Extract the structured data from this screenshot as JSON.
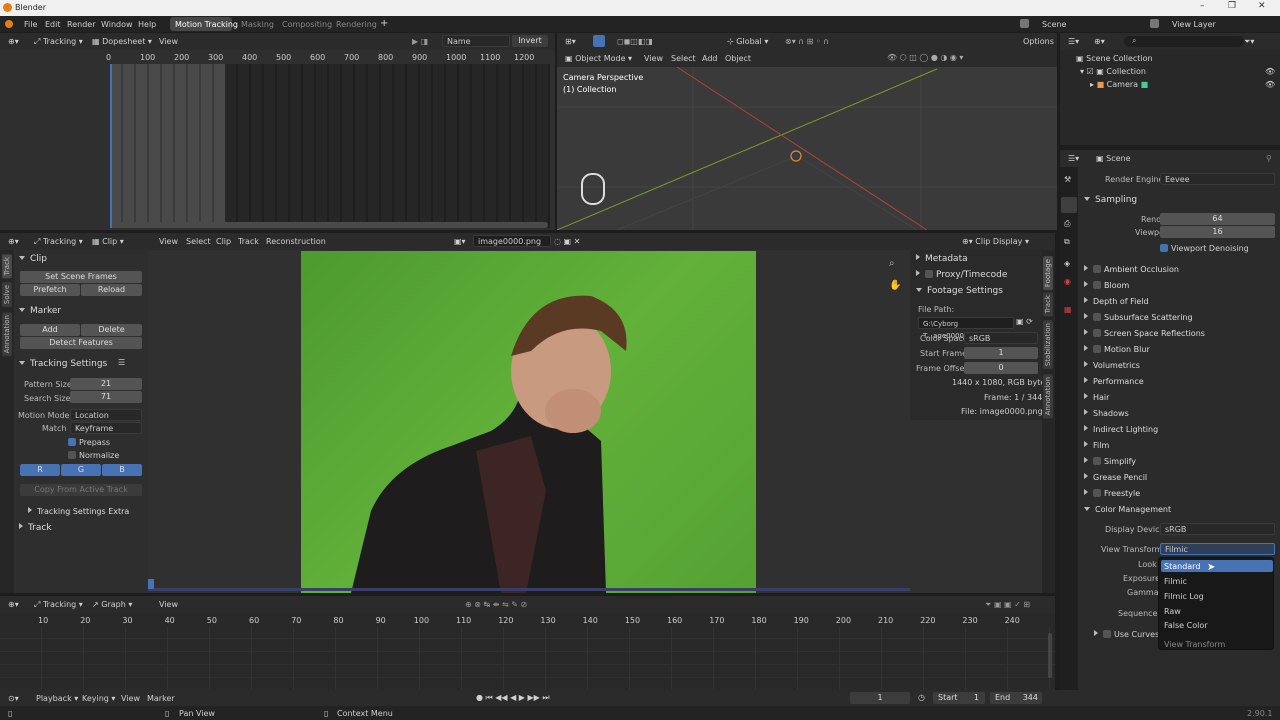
{
  "app": {
    "title": "Blender",
    "version": "2.90.1"
  },
  "topmenu": {
    "items": [
      "File",
      "Edit",
      "Render",
      "Window",
      "Help"
    ],
    "workspaces": [
      "Motion Tracking",
      "Masking",
      "Compositing",
      "Rendering"
    ],
    "add_tab": "+",
    "scene": "Scene",
    "view_layer": "View Layer"
  },
  "dopesheet": {
    "mode": "Tracking",
    "editor": "Dopesheet",
    "view": "View",
    "sort": "Name",
    "invert": "Invert",
    "ticks": [
      "0",
      "100",
      "200",
      "300",
      "400",
      "500",
      "600",
      "700",
      "800",
      "900",
      "1000",
      "1100",
      "1200"
    ]
  },
  "viewport3d": {
    "mode": "Object Mode",
    "menus": [
      "View",
      "Select",
      "Add",
      "Object"
    ],
    "orientation": "Global",
    "options": "Options",
    "overlay_title": "Camera Perspective",
    "overlay_sub": "(1) Collection"
  },
  "outliner": {
    "root": "Scene Collection",
    "collection": "Collection",
    "camera": "Camera"
  },
  "props": {
    "scene": "Scene",
    "render_engine_label": "Render Engine",
    "render_engine": "Eevee",
    "sampling": "Sampling",
    "render_label": "Render",
    "render_val": "64",
    "viewport_label": "Viewport",
    "viewport_val": "16",
    "denoise": "Viewport Denoising",
    "sections": [
      "Ambient Occlusion",
      "Bloom",
      "Depth of Field",
      "Subsurface Scattering",
      "Screen Space Reflections",
      "Motion Blur",
      "Volumetrics",
      "Performance",
      "Hair",
      "Shadows",
      "Indirect Lighting",
      "Film",
      "Simplify",
      "Grease Pencil",
      "Freestyle",
      "Color Management"
    ],
    "display_device_label": "Display Device",
    "display_device": "sRGB",
    "view_transform_label": "View Transform",
    "view_transform": "Filmic",
    "look_label": "Look",
    "exposure_label": "Exposure",
    "gamma_label": "Gamma",
    "sequencer_label": "Sequencer",
    "use_curves": "Use Curves",
    "dropdown": {
      "items": [
        "Standard",
        "Filmic",
        "Filmic Log",
        "Raw",
        "False Color"
      ],
      "title": "View Transform"
    }
  },
  "clip": {
    "mode": "Tracking",
    "editor": "Clip",
    "menus": [
      "View",
      "Select",
      "Clip",
      "Track",
      "Reconstruction"
    ],
    "image": "image0000.png",
    "display": "Clip Display",
    "panel_clip": "Clip",
    "set_scene_frames": "Set Scene Frames",
    "prefetch": "Prefetch",
    "reload": "Reload",
    "panel_marker": "Marker",
    "add": "Add",
    "delete": "Delete",
    "detect": "Detect Features",
    "panel_tracking": "Tracking Settings",
    "pattern_label": "Pattern Size",
    "pattern_val": "21",
    "search_label": "Search Size",
    "search_val": "71",
    "motion_label": "Motion Model",
    "motion_val": "Location",
    "match_label": "Match",
    "match_val": "Keyframe",
    "prepass": "Prepass",
    "normalize": "Normalize",
    "r": "R",
    "g": "G",
    "b": "B",
    "copy": "Copy From Active Track",
    "extra": "Tracking Settings Extra",
    "track": "Track",
    "tabs_left": [
      "Track",
      "Solve",
      "Annotation"
    ],
    "metadata": "Metadata",
    "proxy": "Proxy/Timecode",
    "footage": "Footage Settings",
    "filepath_label": "File Path:",
    "filepath": "G:\\Cyborg T...age0000.png",
    "colorspace_label": "Color Space",
    "colorspace": "sRGB",
    "start_label": "Start Frame",
    "start_val": "1",
    "offset_label": "Frame Offset",
    "offset_val": "0",
    "info1": "1440 x 1080, RGB byte",
    "info2": "Frame: 1 / 344",
    "info3": "File: image0000.png",
    "tabs_right": [
      "Footage",
      "Track",
      "Stabilization",
      "Annotation"
    ]
  },
  "graph": {
    "mode": "Tracking",
    "editor": "Graph",
    "view": "View",
    "ticks": [
      "10",
      "20",
      "30",
      "40",
      "50",
      "60",
      "70",
      "80",
      "90",
      "100",
      "110",
      "120",
      "130",
      "140",
      "150",
      "160",
      "170",
      "180",
      "190",
      "200",
      "210",
      "220",
      "230",
      "240"
    ]
  },
  "timeline": {
    "playback": "Playback",
    "keying": "Keying",
    "view": "View",
    "marker": "Marker",
    "frame": "1",
    "start_label": "Start",
    "start": "1",
    "end_label": "End",
    "end": "344"
  },
  "status": {
    "pan": "Pan View",
    "context": "Context Menu"
  }
}
